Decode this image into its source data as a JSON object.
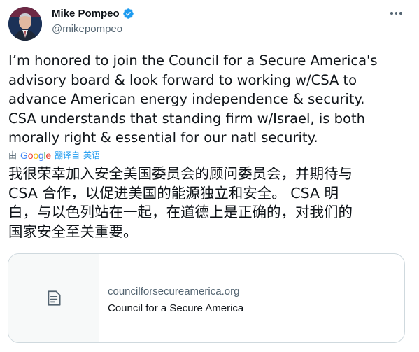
{
  "author": {
    "name": "Mike Pompeo",
    "handle": "@mikepompeo",
    "verified_icon": "verified-badge-icon",
    "avatar_icon": "avatar-photo"
  },
  "tweet": {
    "text": "I’m honored to join the Council for a Secure America's\nadvisory board & look forward to working w/CSA to\nadvance American energy independence & security.\nCSA understands that standing firm w/Israel, is both\nmorally right & essential for our natl security."
  },
  "translation": {
    "prefix": "由",
    "provider": "Google",
    "link_label": "翻译自",
    "source_language": "英语",
    "text": "我很荣幸加入安全美国委员会的顾问委员会，并期待与\nCSA 合作，以促进美国的能源独立和安全。 CSA 明\n白，与以色列站在一起，在道德上是正确的，对我们的\n国家安全至关重要。"
  },
  "link_card": {
    "domain": "councilforsecureamerica.org",
    "title": "Council for a Secure America",
    "icon": "document-icon"
  },
  "colors": {
    "accent": "#1d9bf0",
    "secondary_text": "#536471",
    "border": "#cfd9de"
  },
  "more_icon": "more-options-icon"
}
